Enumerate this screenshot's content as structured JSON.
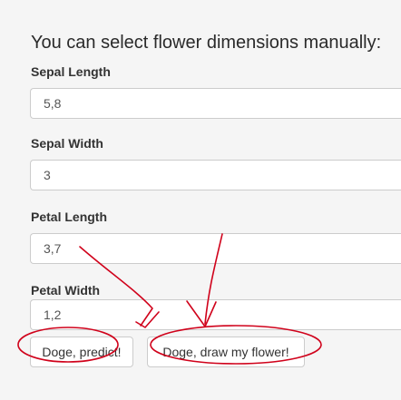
{
  "form": {
    "heading": "You can select flower dimensions manually:",
    "fields": [
      {
        "label": "Sepal Length",
        "value": "5,8"
      },
      {
        "label": "Sepal Width",
        "value": "3"
      },
      {
        "label": "Petal Length",
        "value": "3,7"
      },
      {
        "label": "Petal Width",
        "value": "1,2"
      }
    ],
    "predict_label": "Doge, predict!",
    "draw_label": "Doge, draw my flower!"
  },
  "annotation_color": "#d0021b"
}
